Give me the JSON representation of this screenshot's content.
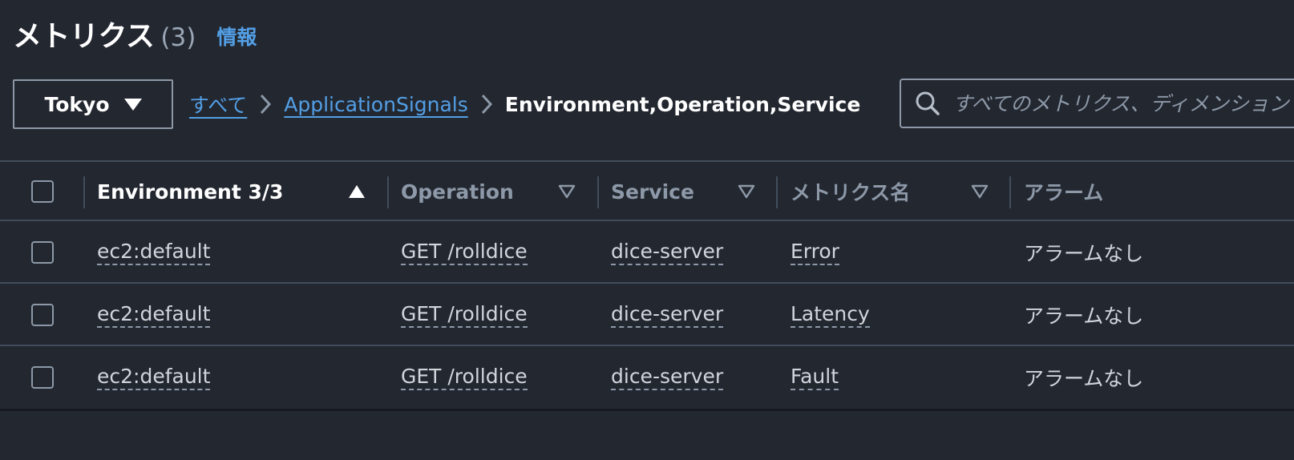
{
  "header": {
    "title": "メトリクス",
    "count": "(3)",
    "info_label": "情報"
  },
  "toolbar": {
    "region": "Tokyo",
    "breadcrumbs": [
      {
        "label": "すべて"
      },
      {
        "label": "ApplicationSignals"
      },
      {
        "label": "Environment,Operation,Service"
      }
    ],
    "search_placeholder": "すべてのメトリクス、ディメンション"
  },
  "table": {
    "columns": [
      {
        "label": "Environment 3/3",
        "sort": "ascending"
      },
      {
        "label": "Operation",
        "sort": "none"
      },
      {
        "label": "Service",
        "sort": "none"
      },
      {
        "label": "メトリクス名",
        "sort": "none"
      },
      {
        "label": "アラーム",
        "sort": "none"
      }
    ],
    "rows": [
      {
        "environment": "ec2:default",
        "operation": "GET /rolldice",
        "service": "dice-server",
        "metric": "Error",
        "alarm": "アラームなし"
      },
      {
        "environment": "ec2:default",
        "operation": "GET /rolldice",
        "service": "dice-server",
        "metric": "Latency",
        "alarm": "アラームなし"
      },
      {
        "environment": "ec2:default",
        "operation": "GET /rolldice",
        "service": "dice-server",
        "metric": "Fault",
        "alarm": "アラームなし"
      }
    ]
  },
  "icons": {
    "region_caret": "caret-down-icon",
    "breadcrumb_separator": "chevron-right-icon",
    "search": "search-icon",
    "sort_ascending": "sort-ascending-icon",
    "sort_none": "sort-descending-outline-icon"
  },
  "colors": {
    "background": "#232730",
    "link": "#539fe5",
    "border": "#414d5c",
    "muted_text": "#8d99a8"
  }
}
